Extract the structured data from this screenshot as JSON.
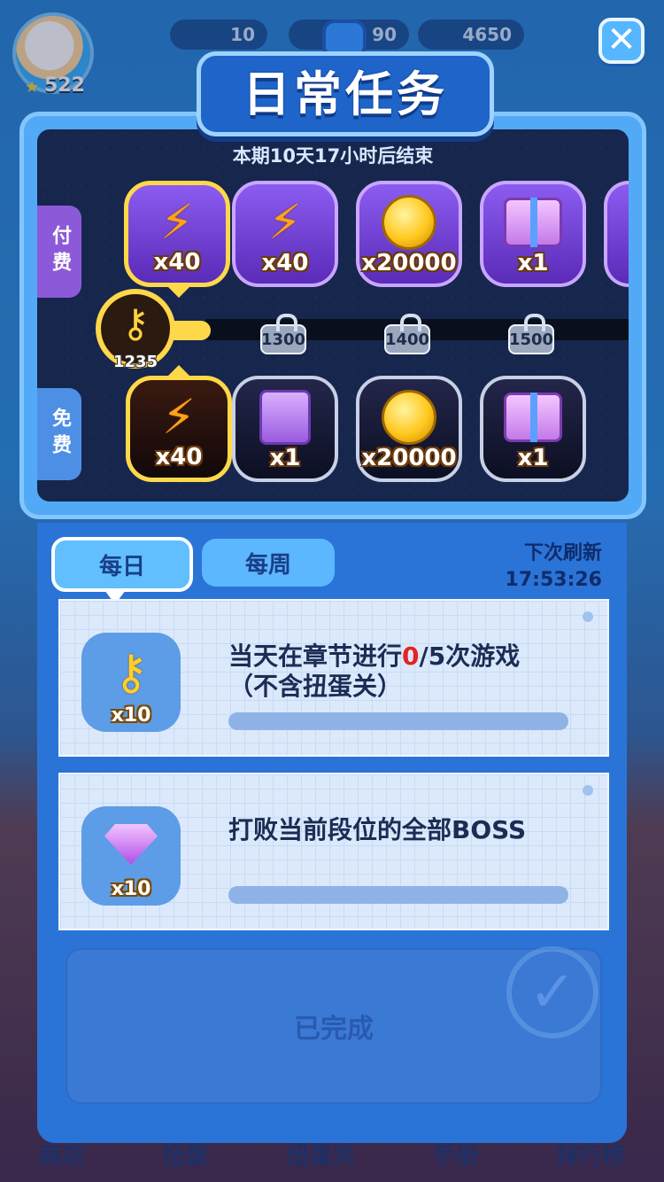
{
  "background": {
    "level": "522",
    "currency": [
      "10",
      "90",
      "4650"
    ],
    "nav": [
      "商店",
      "扭蛋",
      "扭蛋关",
      "手册",
      "排行榜"
    ]
  },
  "header": {
    "title": "日常任务",
    "close_icon": "close-icon"
  },
  "reward_track": {
    "period_text": "本期10天17小时后结束",
    "paid_label": "付费",
    "free_label": "免费",
    "current_keys": "1235",
    "milestones": [
      "1300",
      "1400",
      "1500"
    ],
    "paid_rewards": [
      {
        "icon": "lightning-icon",
        "qty": "x40"
      },
      {
        "icon": "lightning-icon",
        "qty": "x40"
      },
      {
        "icon": "coin-icon",
        "qty": "x20000"
      },
      {
        "icon": "gift-box-icon",
        "qty": "x1"
      }
    ],
    "free_rewards": [
      {
        "icon": "lightning-icon",
        "qty": "x40"
      },
      {
        "icon": "ticket-icon",
        "qty": "x1"
      },
      {
        "icon": "coin-icon",
        "qty": "x20000"
      },
      {
        "icon": "gift-box-icon",
        "qty": "x1"
      }
    ]
  },
  "tasks": {
    "tab_daily": "每日",
    "tab_weekly": "每周",
    "refresh_label": "下次刷新",
    "refresh_time": "17:53:26",
    "items": [
      {
        "reward_qty": "x10",
        "text_pre": "当天在章节进行",
        "text_progress": "0",
        "text_post": "/5次游戏",
        "text_line2": "（不含扭蛋关）",
        "progress": 0
      },
      {
        "reward_qty": "x10",
        "text_pre": "打败当前段位的全部BOSS",
        "progress": 0
      }
    ],
    "completed_label": "已完成"
  },
  "colors": {
    "accent": "#2a74d8",
    "gold": "#ffd84a",
    "paid": "#8c5ad8",
    "highlight": "#e52222"
  }
}
